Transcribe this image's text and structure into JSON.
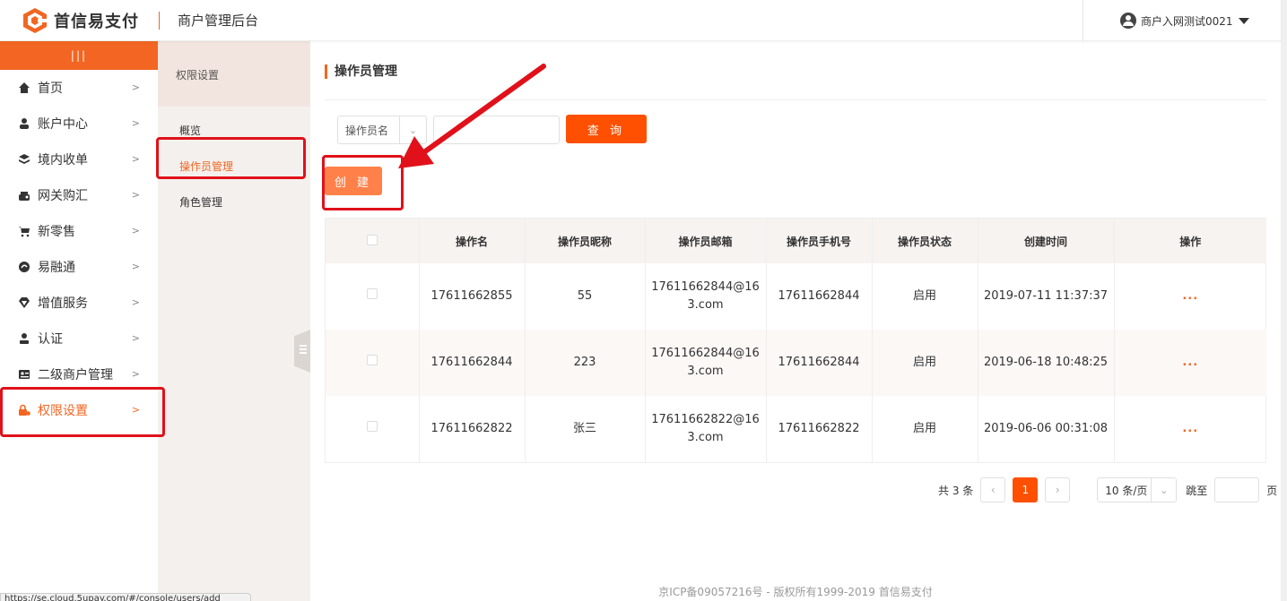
{
  "header": {
    "brand_name": "首信易支付",
    "subtitle": "商户管理后台",
    "user_name": "商户入网测试0021"
  },
  "sidenav": {
    "toggle_glyph": "|||",
    "items": [
      {
        "label": "首页",
        "icon": "home-icon"
      },
      {
        "label": "账户中心",
        "icon": "user-icon"
      },
      {
        "label": "境内收单",
        "icon": "layers-icon"
      },
      {
        "label": "网关购汇",
        "icon": "bank-icon"
      },
      {
        "label": "新零售",
        "icon": "cart-icon"
      },
      {
        "label": "易融通",
        "icon": "finance-icon"
      },
      {
        "label": "增值服务",
        "icon": "diamond-icon"
      },
      {
        "label": "认证",
        "icon": "person-icon"
      },
      {
        "label": "二级商户管理",
        "icon": "idcard-icon"
      },
      {
        "label": "权限设置",
        "icon": "lock-icon",
        "active": true
      }
    ]
  },
  "subnav": {
    "title": "权限设置",
    "items": [
      {
        "label": "概览"
      },
      {
        "label": "操作员管理",
        "active": true
      },
      {
        "label": "角色管理"
      }
    ]
  },
  "main": {
    "title": "操作员管理",
    "filter": {
      "selected": "操作员名",
      "input_value": "",
      "query_label": "查 询"
    },
    "create_label": "创 建",
    "table": {
      "columns": [
        "操作名",
        "操作员昵称",
        "操作员邮箱",
        "操作员手机号",
        "操作员状态",
        "创建时间",
        "操作"
      ],
      "rows": [
        {
          "name": "17611662855",
          "nickname": "55",
          "email_l1": "17611662844@16",
          "email_l2": "3.com",
          "phone": "17611662844",
          "status": "启用",
          "created": "2019-07-11 11:37:37",
          "action": "..."
        },
        {
          "name": "17611662844",
          "nickname": "223",
          "email_l1": "17611662844@16",
          "email_l2": "3.com",
          "phone": "17611662844",
          "status": "启用",
          "created": "2019-06-18 10:48:25",
          "action": "..."
        },
        {
          "name": "17611662822",
          "nickname": "张三",
          "email_l1": "17611662822@16",
          "email_l2": "3.com",
          "phone": "17611662822",
          "status": "启用",
          "created": "2019-06-06 00:31:08",
          "action": "..."
        }
      ]
    },
    "pager": {
      "total": "共 3 条",
      "prev": "‹",
      "current": "1",
      "next": "›",
      "page_size": "10 条/页",
      "jump_label": "跳至",
      "jump_suffix": "页"
    }
  },
  "footer": "京ICP备09057216号 - 版权所有1999-2019 首信易支付",
  "status_url": "https://se.cloud.5upay.com/#/console/users/add",
  "colors": {
    "accent": "#fe5000",
    "annotation": "#e0111a"
  }
}
